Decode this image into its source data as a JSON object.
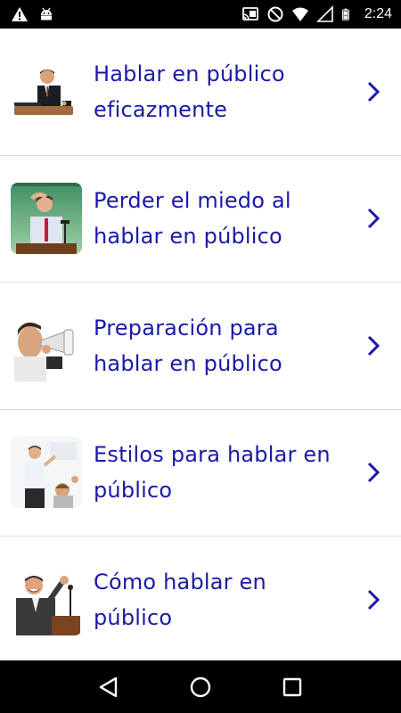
{
  "status_bar": {
    "time": "2:24",
    "left_icons": [
      "warning-icon",
      "android-debug-icon"
    ],
    "right_icons": [
      "cast-icon",
      "do-not-disturb-icon",
      "wifi-icon",
      "no-signal-icon",
      "battery-icon"
    ]
  },
  "items": [
    {
      "label": "Hablar en público eficazmente",
      "thumb": "speaker-at-podium-image"
    },
    {
      "label": "Perder el miedo al hablar en público",
      "thumb": "nervous-speaker-image"
    },
    {
      "label": "Preparación para hablar en público",
      "thumb": "megaphone-man-image"
    },
    {
      "label": "Estilos para hablar en público",
      "thumb": "presenter-audience-image"
    },
    {
      "label": "Cómo hablar en público",
      "thumb": "excited-speaker-image"
    }
  ],
  "colors": {
    "item_text": "#1a1aa6",
    "chevron": "#1a1aa6",
    "divider": "#dcdcdc",
    "bars": "#000000"
  },
  "nav_bar": {
    "buttons": [
      "back-icon",
      "home-icon",
      "recents-icon"
    ]
  }
}
